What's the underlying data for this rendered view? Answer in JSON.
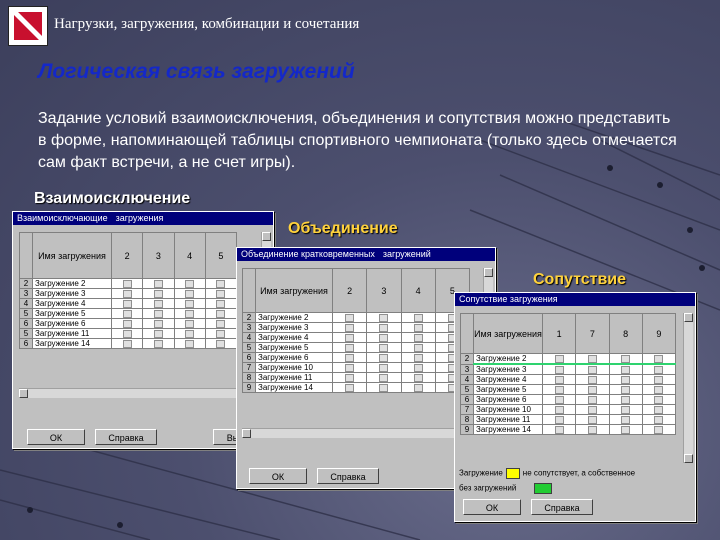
{
  "header": {
    "title": "Нагрузки, загружения, комбинации и сочетания"
  },
  "slide": {
    "title": "Логическая связь загружений",
    "body": "Задание условий взаимоисключения, объединения и сопутствия можно представить в форме, напоминающей таблицы спортивного чемпионата (только здесь отмечается сам факт встречи, а не счет игры)."
  },
  "labels": {
    "exclusion": "Взаимоисключение",
    "union": "Объединение",
    "accompany": "Сопутствие"
  },
  "win1": {
    "title": "Взаимоисключающие",
    "tab": "загружения",
    "name_header": "Имя загружения",
    "columns": [
      "2",
      "3",
      "4",
      "5"
    ],
    "rows": [
      {
        "n": "2",
        "name": "Загружение 2"
      },
      {
        "n": "3",
        "name": "Загружение 3"
      },
      {
        "n": "4",
        "name": "Загружение 4"
      },
      {
        "n": "5",
        "name": "Загружение 5"
      },
      {
        "n": "6",
        "name": "Загружение 6"
      },
      {
        "n": "5",
        "name": "Загружение 11"
      },
      {
        "n": "6",
        "name": "Загружение 14"
      }
    ],
    "ok": "ОК",
    "help": "Справка",
    "extra": "Вы"
  },
  "win2": {
    "title": "Объединение кратковременных",
    "tab": "загружений",
    "name_header": "Имя загружения",
    "columns": [
      "2",
      "3",
      "4",
      "5"
    ],
    "rows": [
      {
        "n": "2",
        "name": "Загружение 2"
      },
      {
        "n": "3",
        "name": "Загружение 3"
      },
      {
        "n": "4",
        "name": "Загружение 4"
      },
      {
        "n": "5",
        "name": "Загружение 5"
      },
      {
        "n": "6",
        "name": "Загружение 6"
      },
      {
        "n": "7",
        "name": "Загружение 10"
      },
      {
        "n": "8",
        "name": "Загружение 11"
      },
      {
        "n": "9",
        "name": "Загружение 14"
      }
    ],
    "ok": "ОК",
    "help": "Справка"
  },
  "win3": {
    "title": "Сопутствие загружения",
    "name_header": "Имя загружения",
    "columns": [
      "1",
      "7",
      "8",
      "9"
    ],
    "rows": [
      {
        "n": "2",
        "name": "Загружение 2"
      },
      {
        "n": "3",
        "name": "Загружение 3"
      },
      {
        "n": "4",
        "name": "Загружение 4"
      },
      {
        "n": "5",
        "name": "Загружение 5"
      },
      {
        "n": "6",
        "name": "Загружение 6"
      },
      {
        "n": "7",
        "name": "Загружение 10"
      },
      {
        "n": "8",
        "name": "Загружение 11"
      },
      {
        "n": "9",
        "name": "Загружение 14"
      }
    ],
    "legend1_pre": "Загружение",
    "legend1_post": "не сопутствует, а собственное",
    "legend2": "без загружений",
    "ok": "ОК",
    "help": "Справка"
  },
  "colors": {
    "title_blue": "#1428c8",
    "titlebar": "#00007b",
    "yellow": "#ffff00",
    "green": "#22cc33"
  }
}
